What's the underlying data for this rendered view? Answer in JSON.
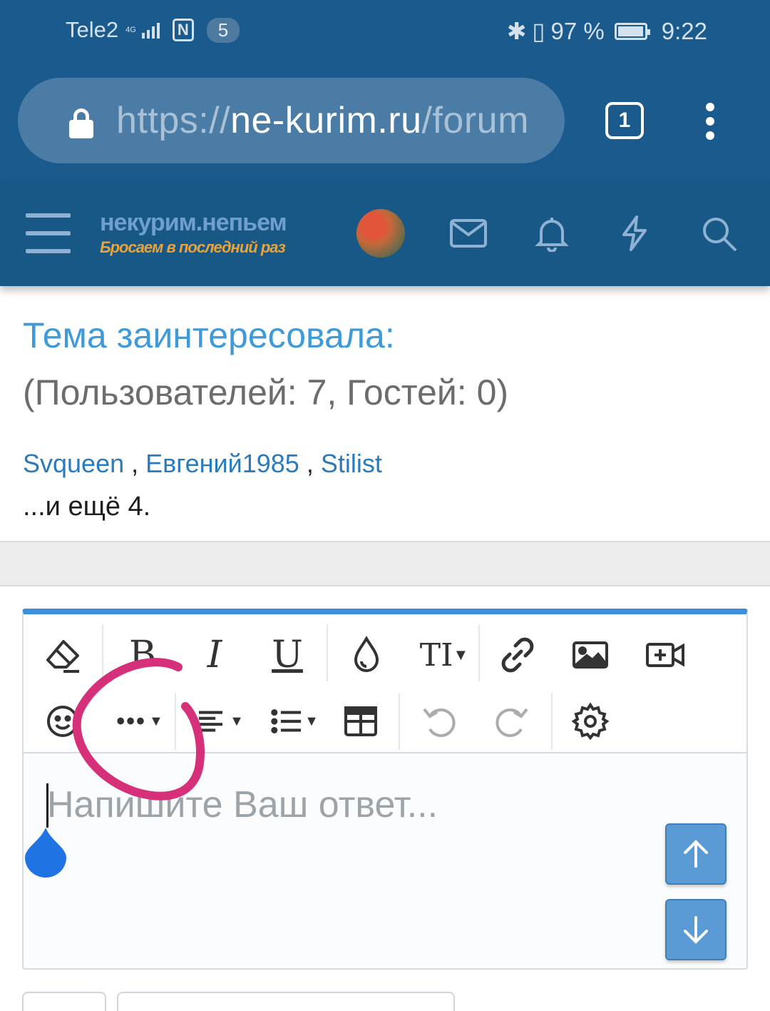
{
  "status_bar": {
    "carrier": "Tele2",
    "network_tag": "4G",
    "notification_count": "5",
    "battery_percent": "97 %",
    "battery_level": 0.97,
    "time": "9:22"
  },
  "browser": {
    "url_scheme": "https://",
    "url_host": "ne-kurim.ru",
    "url_path": "/forum",
    "tab_count": "1"
  },
  "site_header": {
    "logo_main": "некурим.непьем",
    "logo_sub": "Бросаем в последний раз"
  },
  "topic": {
    "title": "Тема заинтересовала:",
    "count_line": "(Пользователей: 7, Гостей: 0)",
    "users": [
      "Svqueen",
      "Евгений1985",
      "Stilist"
    ],
    "separator": " , ",
    "more": "...и ещё 4."
  },
  "editor": {
    "placeholder": "Напишите Ваш ответ...",
    "toolbar_row1": [
      "eraser-icon",
      "bold-icon",
      "italic-icon",
      "underline-icon",
      "color-drop-icon",
      "font-size-icon",
      "link-icon",
      "image-icon",
      "video-icon"
    ],
    "toolbar_row2": [
      "smiley-icon",
      "more-options-icon",
      "align-icon",
      "list-icon",
      "table-icon",
      "undo-icon",
      "redo-icon",
      "settings-icon"
    ],
    "bold_label": "B",
    "italic_label": "I",
    "underline_label": "U",
    "font_size_label": "TI"
  },
  "colors": {
    "header_bg": "#185887",
    "link": "#2a7bbd",
    "title": "#3f9ad9",
    "accent": "#3b90d9",
    "annotation": "#d6307a"
  }
}
